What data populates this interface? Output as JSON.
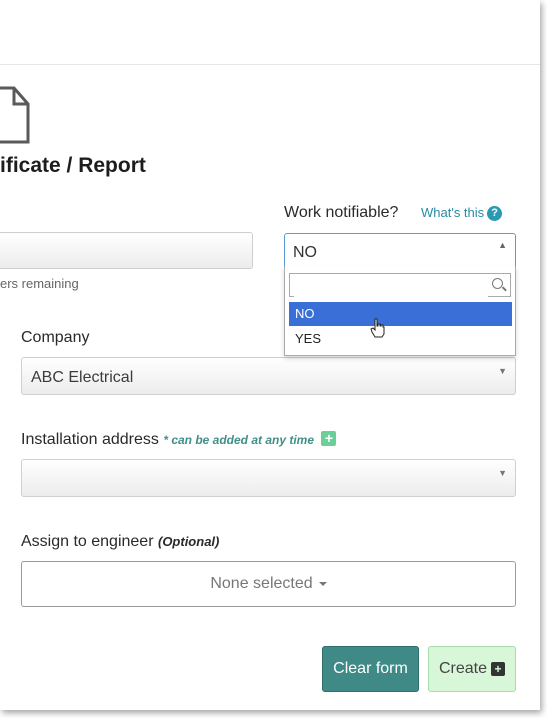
{
  "page": {
    "title": "ificate / Report"
  },
  "form": {
    "chars_remaining": "ers remaining",
    "work_notifiable": {
      "label": "Work notifiable?",
      "help_link": "What's this",
      "help_icon": "?",
      "value": "NO",
      "search_value": "",
      "options": [
        "NO",
        "YES"
      ],
      "highlighted": "NO"
    },
    "company": {
      "label": "Company",
      "value": "ABC Electrical"
    },
    "installation_address": {
      "label": "Installation address",
      "hint": "* can be added at any time",
      "add_icon": "+",
      "value": ""
    },
    "assign_engineer": {
      "label": "Assign to engineer",
      "optional": "(Optional)",
      "value": "None selected"
    },
    "buttons": {
      "clear": "Clear form",
      "create": "Create",
      "create_icon": "+"
    }
  },
  "icons": [
    "document-icon",
    "question-icon",
    "search-icon",
    "plus-icon",
    "caret-down-icon",
    "hand-cursor-icon"
  ],
  "colors": {
    "accent_teal": "#3f8a87",
    "create_bg": "#d8f7d8",
    "highlight": "#3a6fd8",
    "link": "#2a8aa3"
  }
}
